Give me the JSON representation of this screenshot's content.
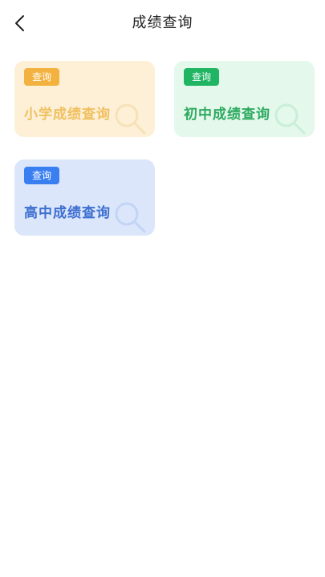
{
  "header": {
    "title": "成绩查询",
    "back_icon": "chevron-left-icon"
  },
  "cards": [
    {
      "badge": "查询",
      "label": "小学成绩查询",
      "accent": "#f3b23f",
      "bg": "#fdf0d6",
      "label_color": "#f0c060"
    },
    {
      "badge": "查询",
      "label": "初中成绩查询",
      "accent": "#1fb563",
      "bg": "#e4f8ec",
      "label_color": "#2eaa60"
    },
    {
      "badge": "查询",
      "label": "高中成绩查询",
      "accent": "#3a7ff2",
      "bg": "#dbe6fb",
      "label_color": "#3d6fd0"
    }
  ]
}
